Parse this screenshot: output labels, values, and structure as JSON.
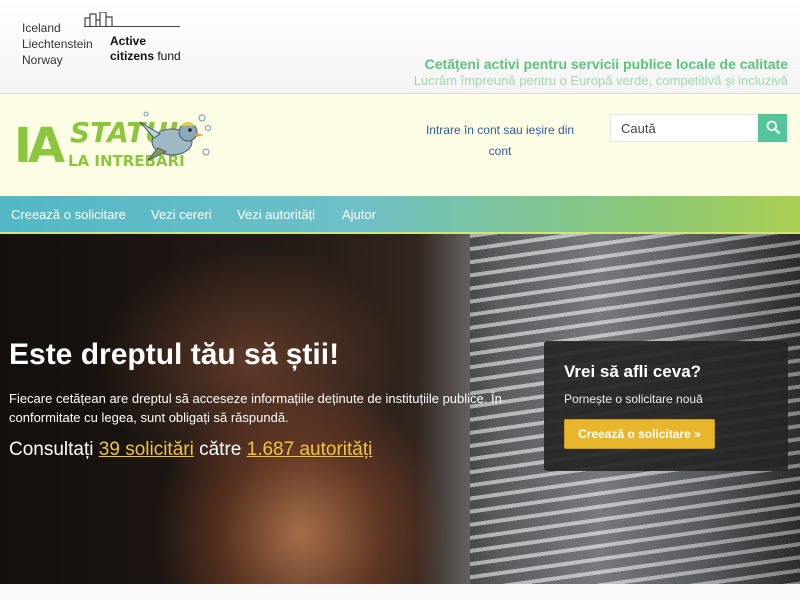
{
  "funder": {
    "countries": [
      "Iceland",
      "Liechtenstein",
      "Norway"
    ],
    "fund_line1": "Active",
    "fund_line2_bold": "citizens",
    "fund_line2": " fund"
  },
  "tagline": {
    "title": "Cetățeni activi pentru servicii publice locale de calitate",
    "subtitle": "Lucrăm împreună pentru o Europă verde, competitivă și incluzivă"
  },
  "logo": {
    "ia": "IA",
    "statul": "STATUL",
    "intrebari": "LA INTREBARI"
  },
  "header": {
    "login_label": "Intrare în cont sau ieșire din cont",
    "search_placeholder": "Caută"
  },
  "nav": {
    "items": [
      {
        "label": "Creează o solicitare"
      },
      {
        "label": "Vezi cereri"
      },
      {
        "label": "Vezi autorități"
      },
      {
        "label": "Ajutor"
      }
    ]
  },
  "hero": {
    "title": "Este dreptul tău să știi!",
    "text": "Fiecare cetățean are dreptul să acceseze informațiile deținute de instituțiile publice. În conformitate cu legea, sunt obligați să răspundă.",
    "stats_prefix": "Consultați ",
    "requests_link": "39 solicitări",
    "stats_middle": " către ",
    "authorities_link": "1.687 autorități"
  },
  "cta": {
    "heading": "Vrei să afli ceva?",
    "subtext": "Pornește o solicitare nouă",
    "button": "Creează o solicitare »"
  },
  "colors": {
    "brand_green": "#8cc63f",
    "tagline_green": "#5dc27a",
    "link_yellow": "#f0c43f",
    "cta_button": "#e8b62c",
    "search_button": "#54c49a"
  }
}
